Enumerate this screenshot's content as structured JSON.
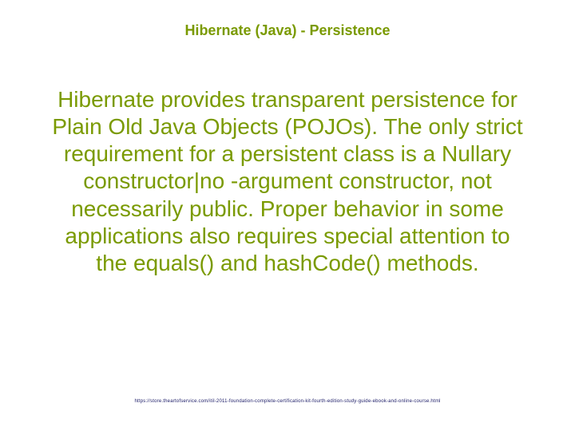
{
  "slide": {
    "title": "Hibernate (Java) - Persistence",
    "body": "Hibernate provides transparent persistence for Plain Old Java Objects (POJOs). The only strict requirement for a persistent class is a Nullary constructor|no -argument constructor, not necessarily public. Proper behavior in some applications also requires special attention to the equals() and hashCode() methods.",
    "footer": "https://store.theartofservice.com/itil-2011-foundation-complete-certification-kit-fourth-edition-study-guide-ebook-and-online-course.html"
  }
}
